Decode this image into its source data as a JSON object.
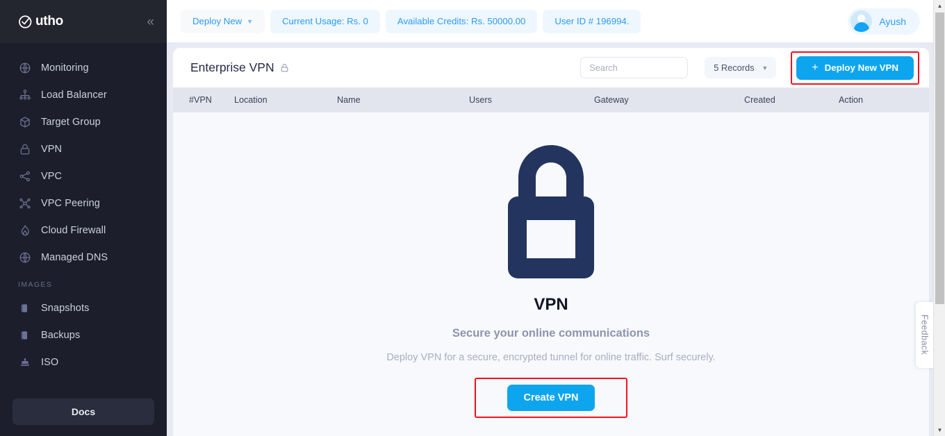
{
  "brand": {
    "name": "utho",
    "logo_icon": "utho-check-circle-logo",
    "collapse_icon": "chevron-double-left-icon"
  },
  "sidebar": {
    "items": [
      {
        "label": "Monitoring",
        "icon": "globe-grid-icon"
      },
      {
        "label": "Load Balancer",
        "icon": "load-balancer-tree-icon"
      },
      {
        "label": "Target Group",
        "icon": "cube-icon"
      },
      {
        "label": "VPN",
        "icon": "lock-icon"
      },
      {
        "label": "VPC",
        "icon": "share-nodes-icon"
      },
      {
        "label": "VPC Peering",
        "icon": "network-peering-icon"
      },
      {
        "label": "Cloud Firewall",
        "icon": "firewall-flame-icon"
      },
      {
        "label": "Managed DNS",
        "icon": "globe-grid-icon"
      }
    ],
    "section_images": "IMAGES",
    "image_items": [
      {
        "label": "Snapshots",
        "icon": "snapshot-box-icon"
      },
      {
        "label": "Backups",
        "icon": "backup-box-icon"
      },
      {
        "label": "ISO",
        "icon": "iso-disc-icon"
      }
    ],
    "docs_label": "Docs"
  },
  "topbar": {
    "deploy_new": "Deploy New",
    "deploy_new_caret_icon": "chevron-down-icon",
    "current_usage": "Current Usage: Rs. 0",
    "available_credits": "Available Credits: Rs. 50000.00",
    "user_id": "User ID # 196994.",
    "user_name": "Ayush",
    "avatar_icon": "user-avatar-icon"
  },
  "card": {
    "title": "Enterprise VPN",
    "title_lock_icon": "lock-icon",
    "search": {
      "value": "",
      "placeholder": "Search",
      "icon": "search-input"
    },
    "records_select": {
      "value": "5 Records",
      "caret_icon": "chevron-down-icon"
    },
    "deploy_button": {
      "label": "Deploy New VPN",
      "plus_icon": "plus-icon"
    },
    "table_headers": [
      "#VPN",
      "Location",
      "Name",
      "Users",
      "Gateway",
      "Created",
      "Action"
    ]
  },
  "empty_state": {
    "illustration_icon": "big-padlock-icon",
    "title": "VPN",
    "subtitle": "Secure your online communications",
    "description": "Deploy VPN for a secure, encrypted tunnel for online traffic. Surf securely.",
    "create_button": "Create VPN"
  },
  "feedback": {
    "label": "Feedback"
  },
  "colors": {
    "accent_blue": "#0ea5ef",
    "sidebar_bg": "#1c1e2b",
    "highlight_red": "#fc0d1b",
    "lock_navy": "#23345f",
    "table_header_bg": "#e2e5ee"
  }
}
